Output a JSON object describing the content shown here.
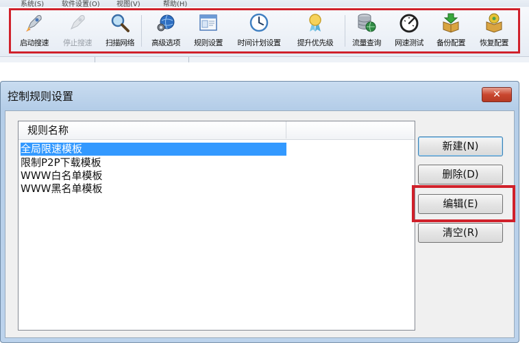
{
  "menu": [
    "系统(S)",
    "软件设置(O)",
    "视图(V)",
    "帮助(H)"
  ],
  "toolbar": [
    {
      "label": "启动搜速",
      "icon": "rocket-icon",
      "enabled": true
    },
    {
      "label": "停止搜速",
      "icon": "rocket-disabled-icon",
      "enabled": false
    },
    {
      "label": "扫描网络",
      "icon": "magnifier-icon",
      "enabled": true
    },
    {
      "label": "高级选项",
      "icon": "globe-gear-icon",
      "enabled": true
    },
    {
      "label": "规则设置",
      "icon": "window-rules-icon",
      "enabled": true
    },
    {
      "label": "时间计划设置",
      "icon": "clock-icon",
      "enabled": true
    },
    {
      "label": "提升优先级",
      "icon": "ribbon-badge-icon",
      "enabled": true
    },
    {
      "label": "流量查询",
      "icon": "database-globe-icon",
      "enabled": true
    },
    {
      "label": "网速测试",
      "icon": "speedometer-icon",
      "enabled": true
    },
    {
      "label": "备份配置",
      "icon": "box-down-arrow-icon",
      "enabled": true
    },
    {
      "label": "恢复配置",
      "icon": "box-gear-icon",
      "enabled": true
    }
  ],
  "dialog": {
    "title": "控制规则设置",
    "close_label": "✕",
    "list_header": "规则名称",
    "rules": [
      "全局限速模板",
      "限制P2P下载模板",
      "WWW白名单模板",
      "WWW黑名单模板"
    ],
    "selected_index": 0,
    "buttons": {
      "new": "新建(N)",
      "delete": "删除(D)",
      "edit": "编辑(E)",
      "clear": "清空(R)"
    }
  },
  "colors": {
    "highlight": "#d0202a",
    "selection": "#3399ff",
    "dialog_frame": "#b4cde8"
  }
}
